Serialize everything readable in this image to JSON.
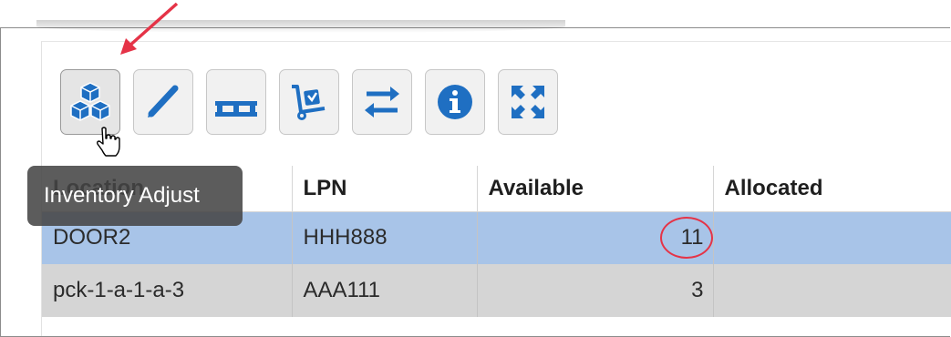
{
  "toolbar": {
    "buttons": [
      {
        "icon": "boxes-icon",
        "tooltip": "Inventory Adjust"
      },
      {
        "icon": "pencil-icon"
      },
      {
        "icon": "pallet-icon"
      },
      {
        "icon": "hand-truck-icon"
      },
      {
        "icon": "swap-arrows-icon"
      },
      {
        "icon": "info-icon"
      },
      {
        "icon": "expand-arrows-icon"
      }
    ]
  },
  "tooltip": {
    "text": "Inventory Adjust"
  },
  "table": {
    "columns": [
      "Location",
      "LPN",
      "Available",
      "Allocated"
    ],
    "rows": [
      {
        "location": "DOOR2",
        "lpn": "HHH888",
        "available": "11",
        "allocated": ""
      },
      {
        "location": "pck-1-a-1-a-3",
        "lpn": "AAA111",
        "available": "3",
        "allocated": ""
      }
    ]
  },
  "colors": {
    "icon_blue": "#1f6fc2",
    "selected_row": "#a8c4e8",
    "plain_row": "#d5d5d5",
    "annotation_red": "#e53347"
  }
}
